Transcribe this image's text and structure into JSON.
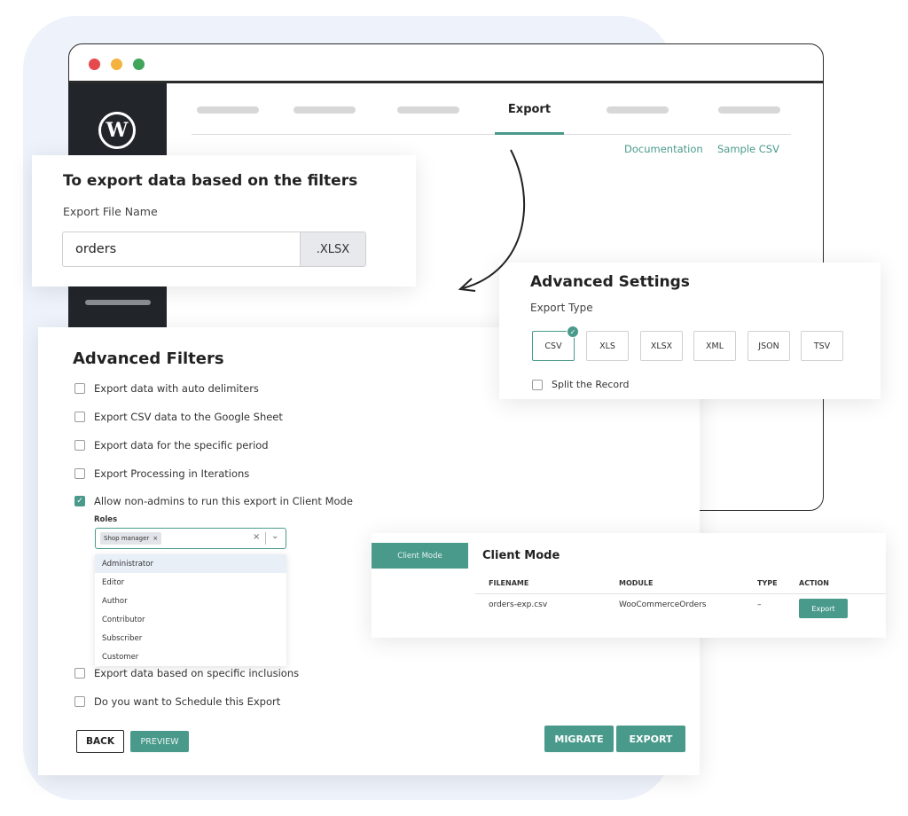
{
  "colors": {
    "accent": "#4a9a8c",
    "sidebar": "#22262b",
    "background_blob": "#eef3fb"
  },
  "browser": {
    "logo_icon": "wordpress-icon",
    "nav": {
      "active_tab": "Export"
    },
    "links": {
      "documentation": "Documentation",
      "sample_csv": "Sample CSV"
    }
  },
  "export_file": {
    "title": "To export data based on the filters",
    "field_label": "Export File Name",
    "file_name": "orders",
    "extension": ".XLSX"
  },
  "advanced_settings": {
    "title": "Advanced Settings",
    "export_type_label": "Export Type",
    "types": [
      "CSV",
      "XLS",
      "XLSX",
      "XML",
      "JSON",
      "TSV"
    ],
    "selected_type": "CSV",
    "split_label": "Split the Record"
  },
  "advanced_filters": {
    "title": "Advanced Filters",
    "options": [
      {
        "label": "Export data with auto delimiters",
        "checked": false
      },
      {
        "label": "Export CSV data to the Google Sheet",
        "checked": false
      },
      {
        "label": "Export data for the specific period",
        "checked": false
      },
      {
        "label": "Export Processing in Iterations",
        "checked": false
      },
      {
        "label": "Allow non-admins to run this export in Client Mode",
        "checked": true
      },
      {
        "label": "Export data based on specific inclusions",
        "checked": false
      },
      {
        "label": "Do you want to Schedule this Export",
        "checked": false
      }
    ],
    "roles_label": "Roles",
    "selected_role_tag": "Shop manager",
    "role_options": [
      "Administrator",
      "Editor",
      "Author",
      "Contributor",
      "Subscriber",
      "Customer"
    ],
    "buttons": {
      "back": "BACK",
      "preview": "PREVIEW",
      "migrate": "MIGRATE",
      "export": "EXPORT"
    }
  },
  "client_mode": {
    "tab_label": "Client Mode",
    "title": "Client Mode",
    "columns": [
      "FILENAME",
      "MODULE",
      "TYPE",
      "ACTION"
    ],
    "row": {
      "filename": "orders-exp.csv",
      "module": "WooCommerceOrders",
      "type": "–",
      "action": "Export"
    }
  }
}
